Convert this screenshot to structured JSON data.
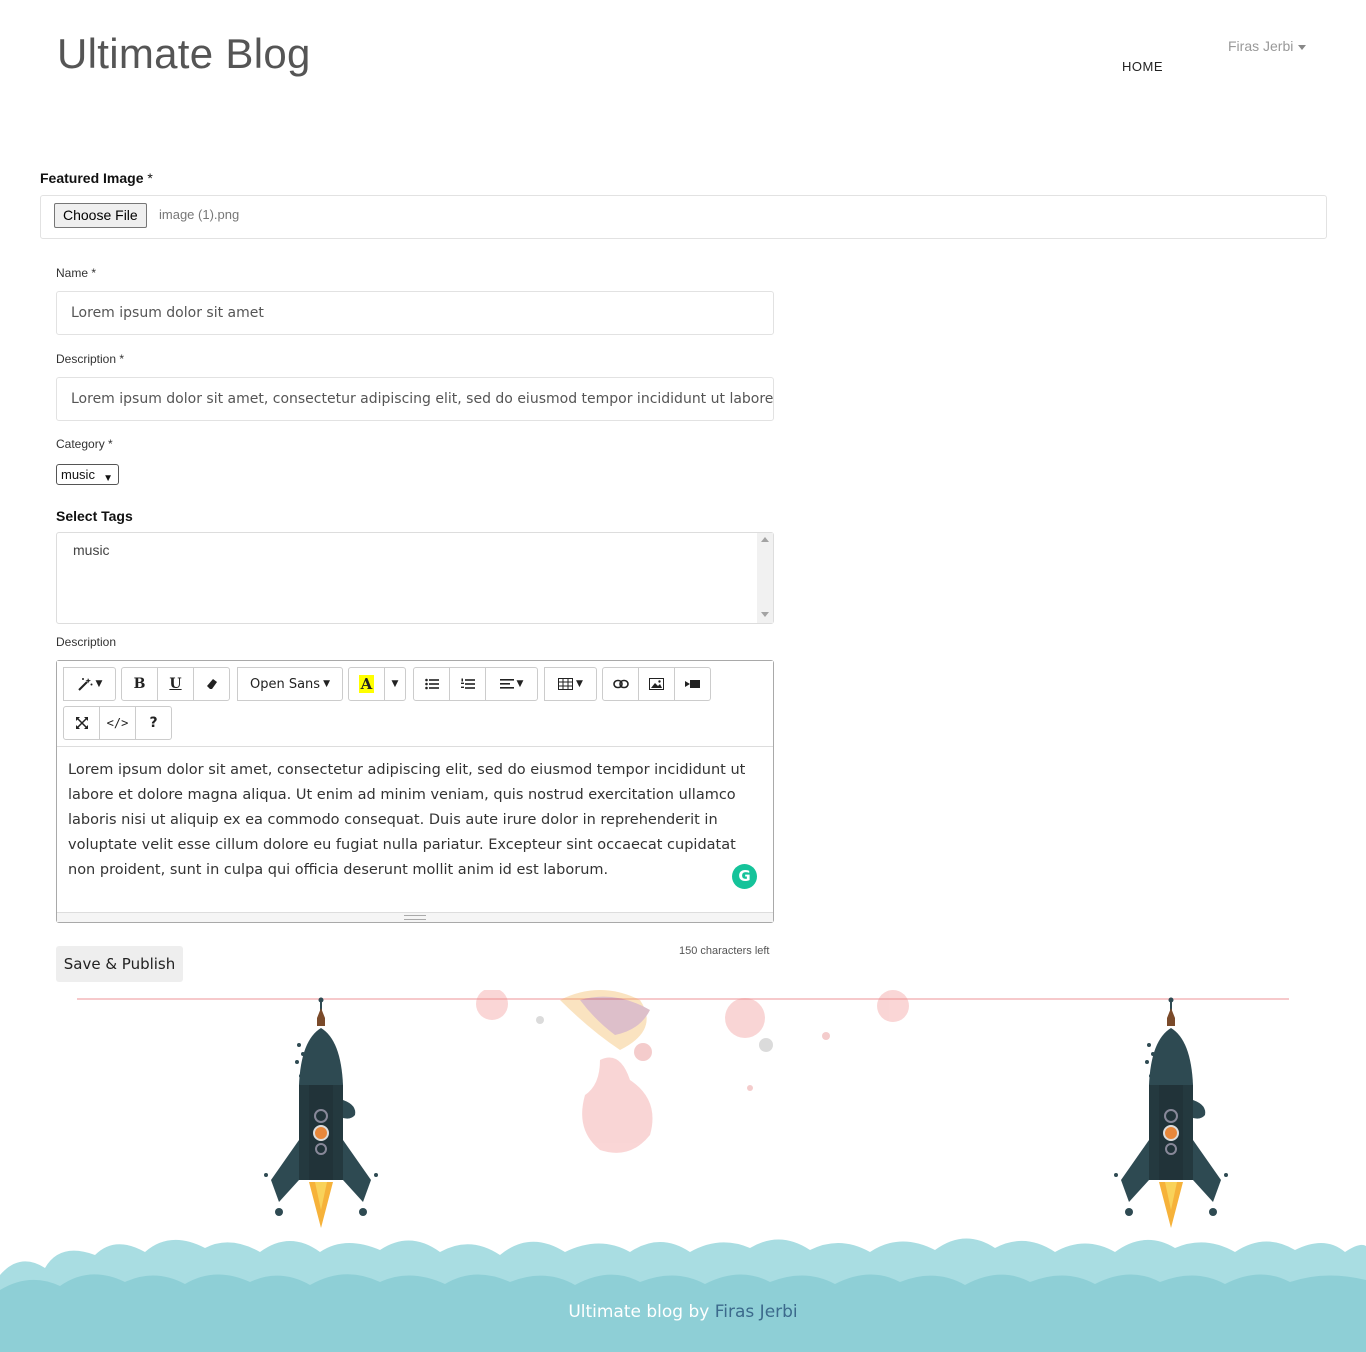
{
  "header": {
    "site_title": "Ultimate Blog",
    "nav_home": "HOME",
    "user_name": "Firas Jerbi"
  },
  "form": {
    "featured_image": {
      "label": "Featured Image",
      "required_mark": "*",
      "button_label": "Choose File",
      "file_name": "image (1).png"
    },
    "name": {
      "label": "Name",
      "required_mark": "*",
      "value": "Lorem ipsum dolor sit amet"
    },
    "short_description": {
      "label": "Description",
      "required_mark": "*",
      "value": "Lorem ipsum dolor sit amet, consectetur adipiscing elit, sed do eiusmod tempor incididunt ut labore et dolo"
    },
    "category": {
      "label": "Category",
      "required_mark": "*",
      "selected": "music"
    },
    "tags": {
      "label": "Select Tags",
      "options": [
        "music"
      ]
    },
    "content": {
      "label": "Description",
      "toolbar": {
        "font_name": "Open Sans",
        "bold": "B",
        "underline": "U",
        "highlight": "A",
        "help": "?",
        "code": "</>"
      },
      "body": "Lorem ipsum dolor sit amet, consectetur adipiscing elit, sed do eiusmod tempor incididunt ut labore et dolore magna aliqua. Ut enim ad minim veniam, quis nostrud exercitation ullamco laboris nisi ut aliquip ex ea commodo consequat. Duis aute irure dolor in reprehenderit in voluptate velit esse cillum dolore eu fugiat nulla pariatur. Excepteur sint occaecat cupidatat non proident, sunt in culpa qui officia deserunt mollit anim id est laborum.",
      "chars_left": "150 characters left"
    },
    "submit_label": "Save & Publish"
  },
  "footer": {
    "text": "Ultimate blog by",
    "author": "Firas Jerbi"
  },
  "colors": {
    "footer_cloud": "#8ecfd6",
    "footer_cloud_light": "#a9dde2",
    "rocket_body": "#2e4a52",
    "grammarly": "#15c39a",
    "accent_line": "#f6c9cb"
  }
}
